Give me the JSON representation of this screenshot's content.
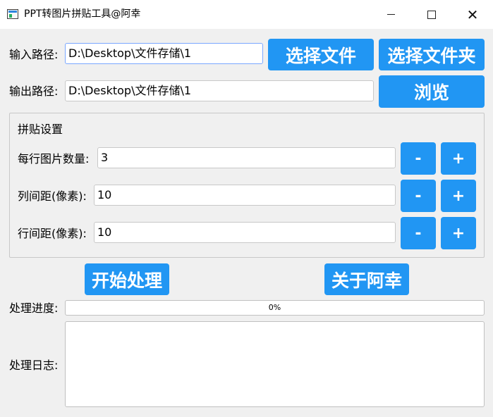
{
  "window": {
    "title": "PPT转图片拼贴工具@阿幸",
    "minimize_glyph": "",
    "maximize_glyph": "",
    "close_glyph": "✕"
  },
  "input": {
    "label": "输入路径:",
    "value": "D:\\Desktop\\文件存储\\1",
    "select_file_label": "选择文件",
    "select_folder_label": "选择文件夹"
  },
  "output": {
    "label": "输出路径:",
    "value": "D:\\Desktop\\文件存储\\1",
    "browse_label": "浏览"
  },
  "collage_settings": {
    "title": "拼贴设置",
    "per_row": {
      "label": "每行图片数量:",
      "value": "3",
      "minus": "-",
      "plus": "+"
    },
    "col_spacing": {
      "label": "列间距(像素):",
      "value": "10",
      "minus": "-",
      "plus": "+"
    },
    "row_spacing": {
      "label": "行间距(像素):",
      "value": "10",
      "minus": "-",
      "plus": "+"
    }
  },
  "actions": {
    "start_label": "开始处理",
    "about_label": "关于阿幸"
  },
  "progress": {
    "label": "处理进度:",
    "text": "0%",
    "value": 0
  },
  "log": {
    "label": "处理日志:",
    "content": ""
  },
  "colors": {
    "accent": "#2196f3",
    "background": "#f0f0f0"
  }
}
